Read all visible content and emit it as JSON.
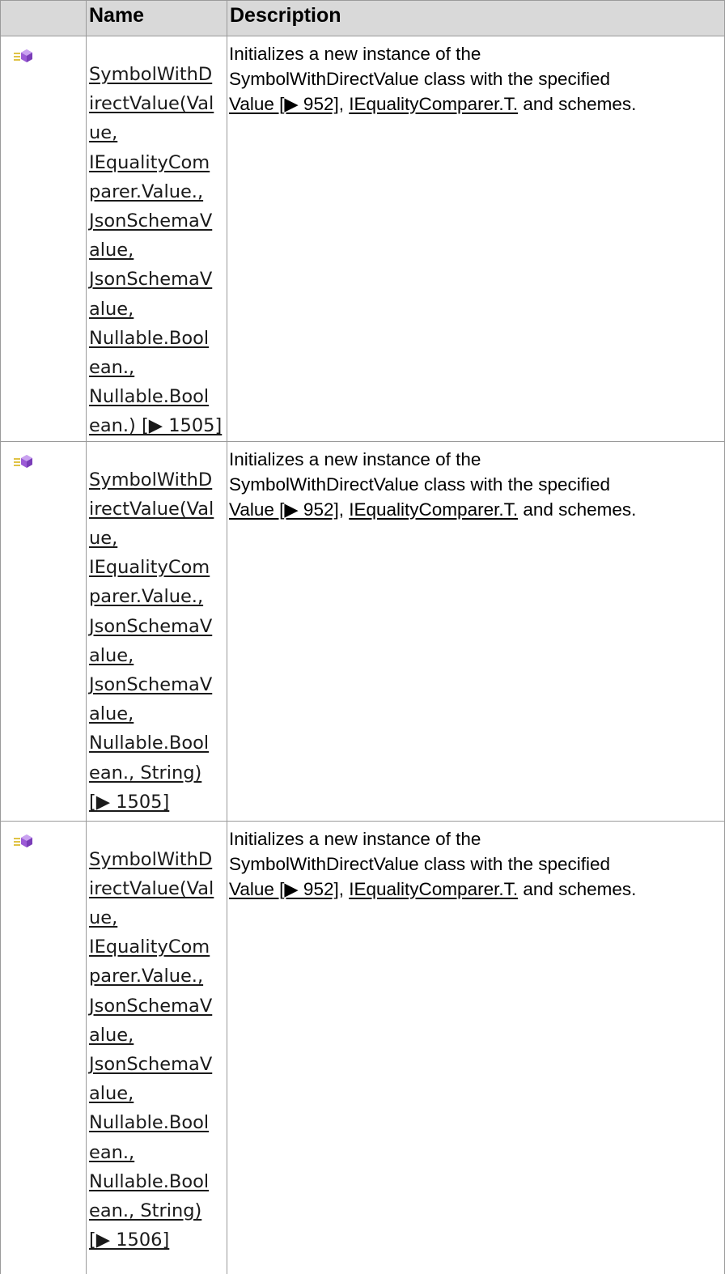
{
  "headers": {
    "name": "Name",
    "description": "Description"
  },
  "icon": "method-icon",
  "colors": {
    "header_bg": "#d9d9d9",
    "border": "#9a9a9a",
    "icon_purple": "#9b5ad6",
    "icon_lines": "#e0c347"
  },
  "rows": [
    {
      "name_lines": [
        "SymbolWithD",
        "irectValue(Val",
        "ue,",
        "IEqualityCom",
        "parer.Value.,",
        "JsonSchemaV",
        "alue,",
        "JsonSchemaV",
        "alue,",
        "Nullable.Bool",
        "ean.,",
        "Nullable.Bool",
        "ean.) [▶ 1505]"
      ],
      "desc_line1": "Initializes a new instance of the",
      "desc_line2": "SymbolWithDirectValue class with the specified",
      "link_value": "Value [▶ 952]",
      "sep": ", ",
      "link_comparer": "IEqualityComparer.T.",
      "tail": " and schemes."
    },
    {
      "name_lines": [
        "SymbolWithD",
        "irectValue(Val",
        "ue,",
        "IEqualityCom",
        "parer.Value.,",
        "JsonSchemaV",
        "alue,",
        "JsonSchemaV",
        "alue,",
        "Nullable.Bool",
        "ean., String)",
        "[▶ 1505]"
      ],
      "desc_line1": "Initializes a new instance of the",
      "desc_line2": "SymbolWithDirectValue class with the specified",
      "link_value": "Value [▶ 952]",
      "sep": ", ",
      "link_comparer": "IEqualityComparer.T.",
      "tail": " and schemes."
    },
    {
      "name_lines": [
        "SymbolWithD",
        "irectValue(Val",
        "ue,",
        "IEqualityCom",
        "parer.Value.,",
        "JsonSchemaV",
        "alue,",
        "JsonSchemaV",
        "alue,",
        "Nullable.Bool",
        "ean.,",
        "Nullable.Bool",
        "ean., String)",
        "[▶ 1506]"
      ],
      "desc_line1": "Initializes a new instance of the",
      "desc_line2": "SymbolWithDirectValue class with the specified",
      "link_value": "Value [▶ 952]",
      "sep": ", ",
      "link_comparer": "IEqualityComparer.T.",
      "tail": " and schemes."
    }
  ]
}
